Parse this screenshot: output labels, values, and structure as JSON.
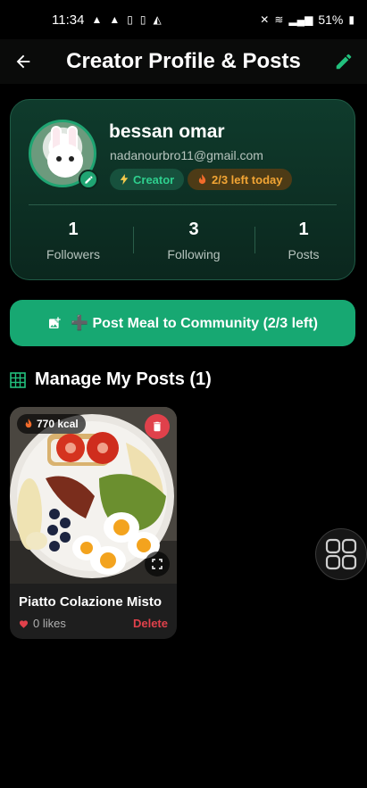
{
  "status_bar": {
    "time": "11:34",
    "battery": "51%"
  },
  "app_bar": {
    "title": "Creator Profile & Posts"
  },
  "profile": {
    "name": "bessan omar",
    "email": "nadanourbro11@gmail.com",
    "badge_creator": "Creator",
    "badge_left": "2/3 left today",
    "stats": [
      {
        "value": "1",
        "label": "Followers"
      },
      {
        "value": "3",
        "label": "Following"
      },
      {
        "value": "1",
        "label": "Posts"
      }
    ]
  },
  "post_button": {
    "label": "➕ Post Meal to Community (2/3 left)"
  },
  "section": {
    "title": "Manage My Posts (1)"
  },
  "posts": [
    {
      "kcal": "770 kcal",
      "title": "Piatto Colazione Misto",
      "likes": "0 likes",
      "delete_label": "Delete"
    }
  ],
  "colors": {
    "accent": "#17a872",
    "danger": "#e0414b",
    "warning": "#f2a534",
    "card_bg": "#0f3b2c"
  },
  "icons": [
    "back-arrow-icon",
    "edit-pencil-icon",
    "bolt-icon",
    "fire-icon",
    "add-photo-icon",
    "grid-icon",
    "trash-icon",
    "expand-icon",
    "heart-icon",
    "apps-grid-icon"
  ]
}
